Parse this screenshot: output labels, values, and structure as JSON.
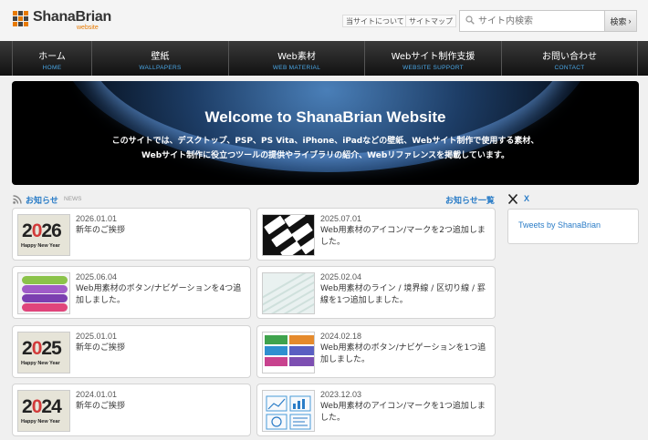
{
  "site": {
    "logo_name": "ShanaBrian",
    "logo_sub": "website"
  },
  "toplinks": [
    "当サイトについて",
    "サイトマップ"
  ],
  "search": {
    "placeholder": "サイト内検索",
    "button_label": "検索"
  },
  "nav": [
    {
      "jp": "ホーム",
      "en": "HOME"
    },
    {
      "jp": "壁紙",
      "en": "WALLPAPERS"
    },
    {
      "jp": "Web素材",
      "en": "WEB MATERIAL"
    },
    {
      "jp": "Webサイト制作支援",
      "en": "WEBSITE SUPPORT"
    },
    {
      "jp": "お問い合わせ",
      "en": "CONTACT"
    }
  ],
  "hero": {
    "title": "Welcome to ShanaBrian Website",
    "line1": "このサイトでは、デスクトップ、PSP、PS Vita、iPhone、iPadなどの壁紙、Webサイト制作で使用する素材、",
    "line2": "Webサイト制作に役立つツールの提供やライブラリの紹介、Webリファレンスを掲載しています。"
  },
  "news": {
    "title": "お知らせ",
    "title_en": "NEWS",
    "all_link": "お知らせ一覧",
    "items": [
      {
        "date": "2026.01.01",
        "text": "新年のご挨拶",
        "thumb_year": "2026"
      },
      {
        "date": "2025.07.01",
        "text": "Web用素材のアイコン/マークを2つ追加しました。"
      },
      {
        "date": "2025.06.04",
        "text": "Web用素材のボタン/ナビゲーションを4つ追加しました。"
      },
      {
        "date": "2025.02.04",
        "text": "Web用素材のライン / 境界線 / 区切り線 / 罫線を1つ追加しました。"
      },
      {
        "date": "2025.01.01",
        "text": "新年のご挨拶",
        "thumb_year": "2025"
      },
      {
        "date": "2024.02.18",
        "text": "Web用素材のボタン/ナビゲーションを1つ追加しました。"
      },
      {
        "date": "2024.01.01",
        "text": "新年のご挨拶",
        "thumb_year": "2024"
      },
      {
        "date": "2023.12.03",
        "text": "Web用素材のアイコン/マークを1つ追加しました。"
      }
    ],
    "thumb_caption": "Happy New Year"
  },
  "sidebar": {
    "x_label": "X",
    "tweets_link": "Tweets by ShanaBrian"
  },
  "colors": {
    "accent": "#2a7cc7",
    "logo_sub": "#e77a00",
    "nav_en": "#4aa8e8"
  }
}
